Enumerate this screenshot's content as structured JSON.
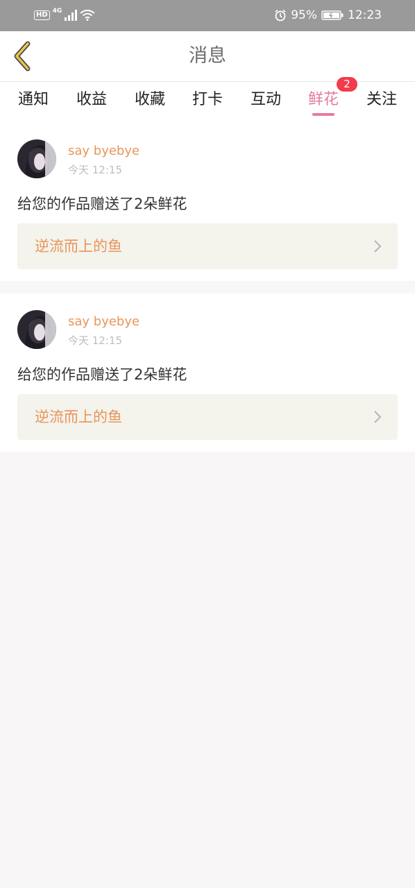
{
  "status_bar": {
    "hd": "HD",
    "network": "4G",
    "battery": "95%",
    "time": "12:23",
    "icons": [
      "signal-icon",
      "wifi-icon",
      "alarm-icon",
      "battery-icon"
    ]
  },
  "header": {
    "title": "消息",
    "back_icon": "chevron-left-icon"
  },
  "tabs": [
    {
      "label": "通知"
    },
    {
      "label": "收益"
    },
    {
      "label": "收藏"
    },
    {
      "label": "打卡"
    },
    {
      "label": "互动"
    },
    {
      "label": "鲜花",
      "active": true,
      "badge": "2"
    },
    {
      "label": "关注"
    }
  ],
  "messages": [
    {
      "username": "say byebye",
      "time": "今天 12:15",
      "text": "给您的作品赠送了2朵鲜花",
      "work_title": "逆流而上的鱼"
    },
    {
      "username": "say byebye",
      "time": "今天 12:15",
      "text": "给您的作品赠送了2朵鲜花",
      "work_title": "逆流而上的鱼"
    }
  ],
  "colors": {
    "accent_pink": "#e57aa4",
    "accent_orange": "#e8955a",
    "back_arrow": "#e8c64b",
    "badge_red": "#f23b4b"
  }
}
